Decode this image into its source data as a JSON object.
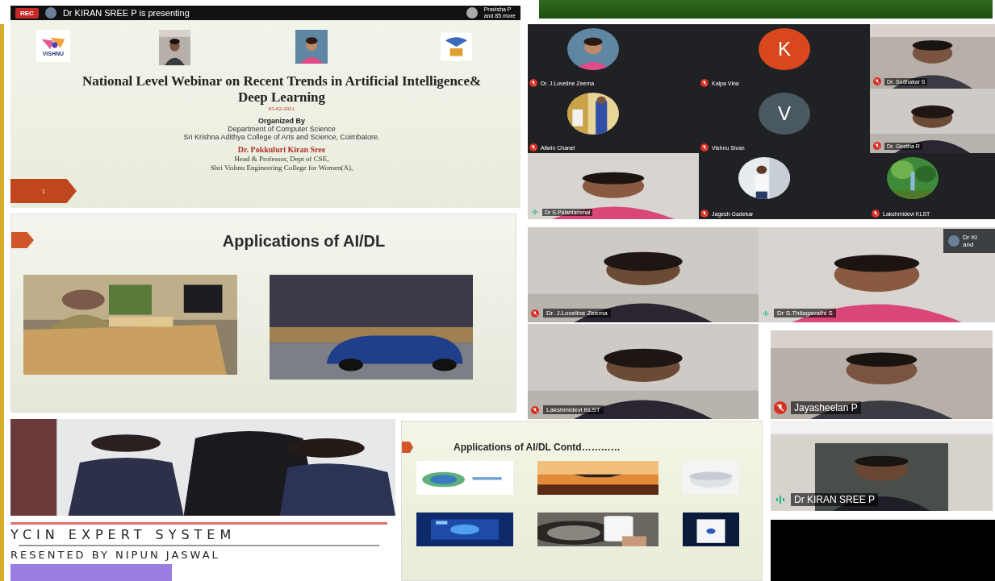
{
  "meeting_bar": {
    "rec_label": "REC",
    "presenting": "Dr KIRAN SREE P is presenting",
    "participants": [
      "Pravisha P",
      "and 85 more"
    ]
  },
  "title_slide": {
    "logo_text": "VISHNU",
    "slide_number": "1",
    "title": "National Level Webinar on Recent Trends in Artificial Intelligence& Deep Learning",
    "date": "05-02-2021",
    "organizer_heading": "Organized By",
    "organizer_lines": [
      "Department of Computer Science",
      "Sri Krishna Adithya College of Arts and Science, Coimbatore."
    ],
    "speaker": "Dr. Pokkuluri Kiran Sree",
    "speaker_lines": [
      "Head & Professor, Dept of CSE,",
      "Shri Vishnu Engineering College for Women(A),"
    ]
  },
  "gallery": {
    "tiles": [
      {
        "name": "Dr. J.Loveline Zeema",
        "muted": true
      },
      {
        "kind": "letter",
        "letter": "K",
        "color": "#d9481c",
        "name": "Kalpa Vina",
        "muted": true
      },
      {
        "kind": "video",
        "name": "Dr. Sudhakar S",
        "muted": true
      },
      {
        "name": "Allwin Chanel",
        "muted": true
      },
      {
        "kind": "letter",
        "letter": "V",
        "color": "#4a5862",
        "name": "Vishnu Sivan",
        "muted": true
      },
      {
        "kind": "video",
        "name": "Dr. Geetha R",
        "muted": true
      },
      {
        "kind": "video",
        "name": "Dr S.Palaniammal",
        "muted": false
      },
      {
        "name": "Jagesh Gadekar",
        "muted": true
      },
      {
        "name": "Lakshmidevi KLST",
        "muted": true
      }
    ]
  },
  "slide_two": {
    "title": "Applications of AI/DL"
  },
  "video_grid": {
    "self_view": [
      "Dr Ki",
      "and"
    ],
    "tiles": [
      {
        "name": "Dr. J.Loveline Zeema",
        "muted": true
      },
      {
        "name": "Dr S.Thilagavathi S",
        "muted": false
      },
      {
        "name": "Lakshmidevi KLST",
        "muted": true
      },
      {
        "name": "Jayasheelan P",
        "muted": true
      },
      {
        "name": "Dr KIRAN SREE P",
        "muted": false
      }
    ]
  },
  "newspaper": {
    "headline": "YCIN EXPERT SYSTEM",
    "byline": "RESENTED BY NIPUN JASWAL"
  },
  "slide_three": {
    "title": "Applications of AI/DL Contd…………"
  }
}
